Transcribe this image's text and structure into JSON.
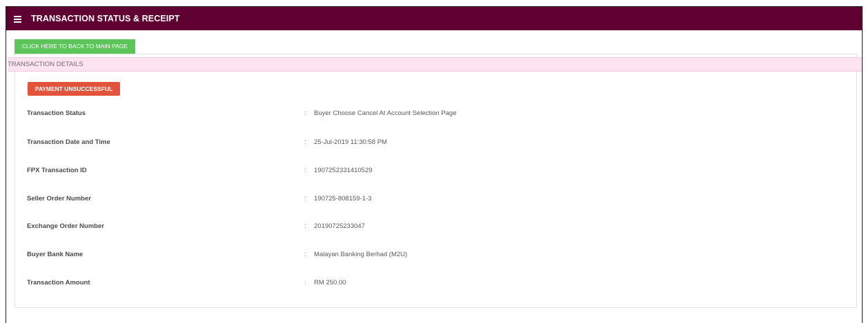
{
  "header": {
    "title": "TRANSACTION STATUS & RECEIPT",
    "menu_icon": "hamburger-menu-icon"
  },
  "back_button_label": "CLICK HERE TO BACK TO MAIN PAGE",
  "panel": {
    "heading": "TRANSACTION DETAILS",
    "status_badge": "PAYMENT UNSUCCESSFUL",
    "separator": ":",
    "details": [
      {
        "label": "Transaction Status",
        "value": "Buyer Choose Cancel At Account Selection Page"
      },
      {
        "label": "Transaction Date and Time",
        "value": "25-Jul-2019 11:30:58 PM"
      },
      {
        "label": "FPX Transaction ID",
        "value": "1907252331410529"
      },
      {
        "label": "Seller Order Number",
        "value": "190725-808159-1-3"
      },
      {
        "label": "Exchange Order Number",
        "value": "20190725233047"
      },
      {
        "label": "Buyer Bank Name",
        "value": "Malayan Banking Berhad (M2U)"
      },
      {
        "label": "Transaction Amount",
        "value": "RM 250.00"
      }
    ]
  },
  "colors": {
    "header_bg": "#600032",
    "back_button_bg": "#5cc55a",
    "heading_bg": "#fde3ef",
    "badge_bg": "#e2533b"
  }
}
